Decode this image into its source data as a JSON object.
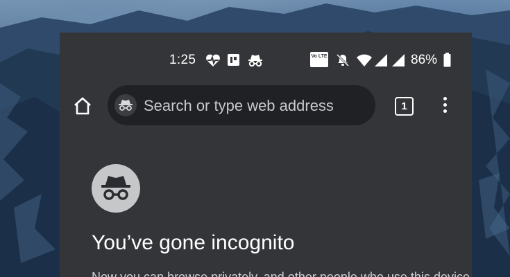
{
  "status_bar": {
    "time": "1:25",
    "notification_icons": [
      "heart-pulse-icon",
      "card-icon",
      "incognito-icon"
    ],
    "system_icons": [
      "volte-icon",
      "notifications-muted-icon",
      "wifi-icon",
      "cell-signal-icon",
      "cell-signal-icon"
    ],
    "volte_label": "Vo LTE",
    "battery_percent": "86%"
  },
  "toolbar": {
    "home_icon": "home-icon",
    "omnibox_icon": "incognito-icon",
    "omnibox_placeholder": "Search or type web address",
    "tab_count": "1",
    "menu_icon": "more-vert-icon"
  },
  "ntp": {
    "avatar_icon": "incognito-icon",
    "headline": "You’ve gone incognito",
    "body": "Now you can browse privately, and other people who use this device won’t see your activity."
  },
  "colors": {
    "surface": "#343538",
    "omnibox": "#202124",
    "text_primary": "#ffffff",
    "avatar_bg": "#c6c7c9"
  }
}
